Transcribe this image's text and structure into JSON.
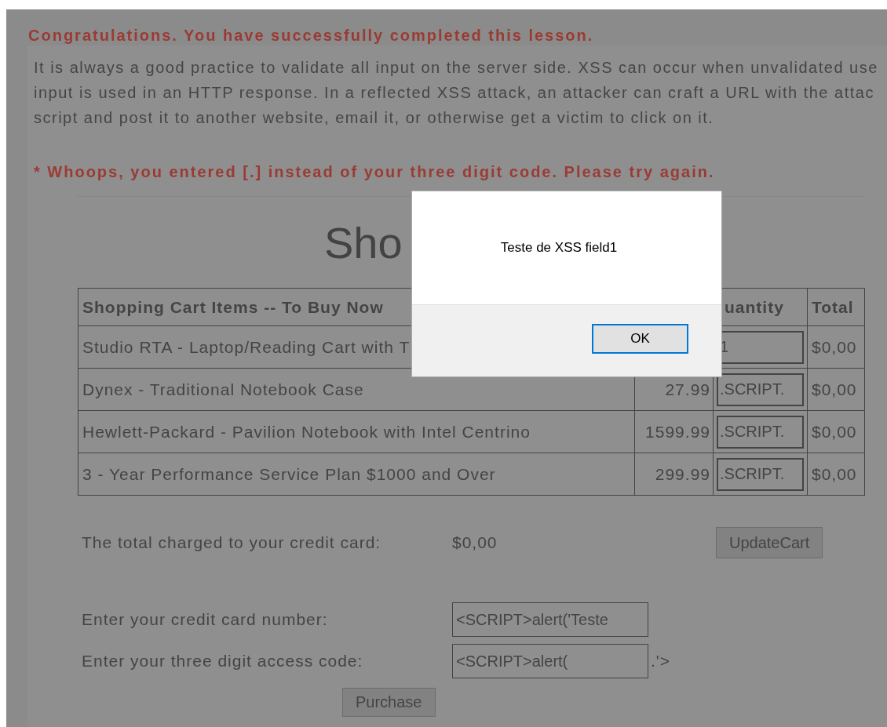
{
  "lesson_status": "Congratulations. You have successfully completed this lesson.",
  "explanation": [
    "It is always a good practice to validate all input on the server side. XSS can occur when unvalidated use",
    "input is used in an HTTP response. In a reflected XSS attack, an attacker can craft a URL with the attac",
    "script and post it to another website, email it, or otherwise get a victim to click on it."
  ],
  "error_message": "* Whoops, you entered [.] instead of your three digit code. Please try again.",
  "cart_title": "Sho",
  "table": {
    "columns": [
      "Shopping Cart Items -- To Buy Now",
      "",
      "uantity",
      "Total"
    ],
    "rows": [
      {
        "item": "Studio RTA - Laptop/Reading Cart with T",
        "price": "",
        "quantity": "1",
        "total": "$0,00"
      },
      {
        "item": "Dynex - Traditional Notebook Case",
        "price": "27.99",
        "quantity": ".SCRIPT.",
        "total": "$0,00"
      },
      {
        "item": "Hewlett-Packard - Pavilion Notebook with Intel Centrino",
        "price": "1599.99",
        "quantity": ".SCRIPT.",
        "total": "$0,00"
      },
      {
        "item": "3 - Year Performance Service Plan $1000 and Over",
        "price": "299.99",
        "quantity": ".SCRIPT.",
        "total": "$0,00"
      }
    ]
  },
  "total_label": "The total charged to your credit card:",
  "total_value": "$0,00",
  "update_button": "UpdateCart",
  "card_label": "Enter your credit card number:",
  "card_value": "<SCRIPT>alert('Teste",
  "code_label": "Enter your three digit access code:",
  "code_value": "<SCRIPT>alert(",
  "code_suffix": ".'>",
  "purchase_button": "Purchase",
  "dialog": {
    "message": "Teste de XSS field1",
    "button": {
      "label": "OK",
      "focused": true
    }
  }
}
